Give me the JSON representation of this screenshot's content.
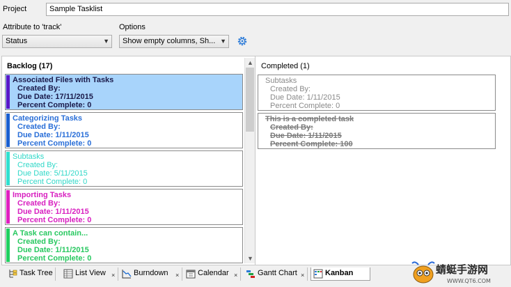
{
  "project": {
    "label": "Project",
    "value": "Sample Tasklist"
  },
  "attribute": {
    "label": "Attribute to 'track'",
    "value": "Status"
  },
  "options": {
    "label": "Options",
    "value": "Show empty columns, Sh..."
  },
  "backlog": {
    "header": "Backlog (17)",
    "cards": [
      {
        "title": "Associated Files with Tasks",
        "created": "Created By:",
        "due": "Due Date: 17/11/2015",
        "percent": "Percent Complete: 0",
        "color": "#5a18c8",
        "text_color": "#1a1a4a"
      },
      {
        "title": "Categorizing Tasks",
        "created": "Created By:",
        "due": "Due Date: 1/11/2015",
        "percent": "Percent Complete: 0",
        "color": "#1a5fd0",
        "text_color": "#2a6fd8"
      },
      {
        "title": "Subtasks",
        "created": "Created By:",
        "due": "Due Date: 5/11/2015",
        "percent": "Percent Complete: 0",
        "color": "#30e0d0",
        "text_color": "#30d8c8"
      },
      {
        "title": "Importing Tasks",
        "created": "Created By:",
        "due": "Due Date: 1/11/2015",
        "percent": "Percent Complete: 0",
        "color": "#e020c0",
        "text_color": "#d820c0"
      },
      {
        "title": "A Task can contain...",
        "created": "Created By:",
        "due": "Due Date: 1/11/2015",
        "percent": "Percent Complete: 0",
        "color": "#20d060",
        "text_color": "#28c860"
      }
    ]
  },
  "completed": {
    "header": "Completed (1)",
    "cards": [
      {
        "title": "Subtasks",
        "created": "Created By:",
        "due": "Due Date: 1/11/2015",
        "percent": "Percent Complete: 0"
      },
      {
        "title": "This is a completed task",
        "created": "Created By:",
        "due": "Due Date: 1/11/2015",
        "percent": "Percent Complete: 100"
      }
    ]
  },
  "tabs": [
    {
      "label": "Task Tree",
      "icon": "task-tree-icon",
      "closable": false
    },
    {
      "label": "List View",
      "icon": "list-view-icon",
      "closable": true
    },
    {
      "label": "Burndown",
      "icon": "burndown-chart-icon",
      "closable": true
    },
    {
      "label": "Calendar",
      "icon": "calendar-icon",
      "closable": true
    },
    {
      "label": "Gantt Chart",
      "icon": "gantt-chart-icon",
      "closable": true
    },
    {
      "label": "Kanban",
      "icon": "kanban-icon",
      "closable": false,
      "active": true
    }
  ],
  "close_glyph": "×",
  "watermark": {
    "name": "蜻蜓手游网",
    "url": "WWW.QT6.COM"
  }
}
